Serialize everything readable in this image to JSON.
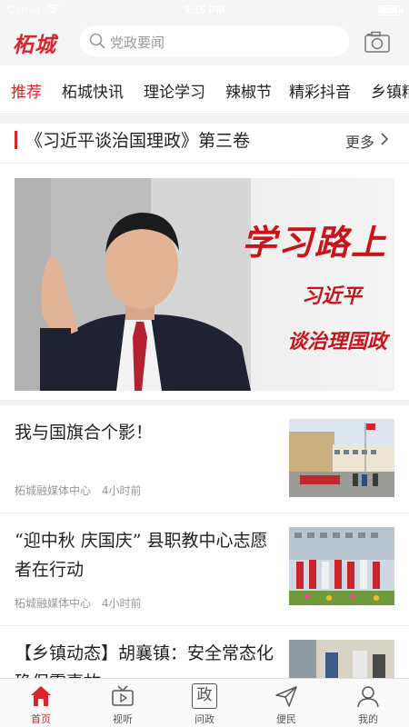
{
  "status_bar": {
    "carrier": "Carrier",
    "time": "9:15 PM"
  },
  "header": {
    "logo_text": "柘城",
    "search_placeholder": "党政要闻"
  },
  "tabs": [
    {
      "label": "推荐",
      "active": true
    },
    {
      "label": "柘城快讯"
    },
    {
      "label": "理论学习"
    },
    {
      "label": "辣椒节"
    },
    {
      "label": "精彩抖音"
    },
    {
      "label": "乡镇精"
    }
  ],
  "section": {
    "title": "《习近平谈治国理政》第三卷",
    "more_label": "更多"
  },
  "banner": {
    "line1": "学习路上",
    "line2": "习近平",
    "line3": "谈治理国政"
  },
  "news": [
    {
      "headline": "我与国旗合个影！",
      "source": "柘城融媒体中心",
      "time": "4小时前"
    },
    {
      "headline": "“迎中秋 庆国庆” 县职教中心志愿者在行动",
      "source": "柘城融媒体中心",
      "time": "4小时前"
    },
    {
      "headline": "【乡镇动态】胡襄镇：安全常态化 确保零事故",
      "source": "",
      "time": ""
    }
  ],
  "bottom_nav": [
    {
      "label": "首页",
      "icon": "home-icon",
      "active": true
    },
    {
      "label": "视听",
      "icon": "tv-icon"
    },
    {
      "label": "问政",
      "icon": "wenzheng-icon",
      "glyph": "政"
    },
    {
      "label": "便民",
      "icon": "send-icon"
    },
    {
      "label": "我的",
      "icon": "user-icon"
    }
  ],
  "colors": {
    "accent": "#d9242b",
    "header_bg": "#f5f5f5",
    "divider": "#f2f2f2"
  }
}
